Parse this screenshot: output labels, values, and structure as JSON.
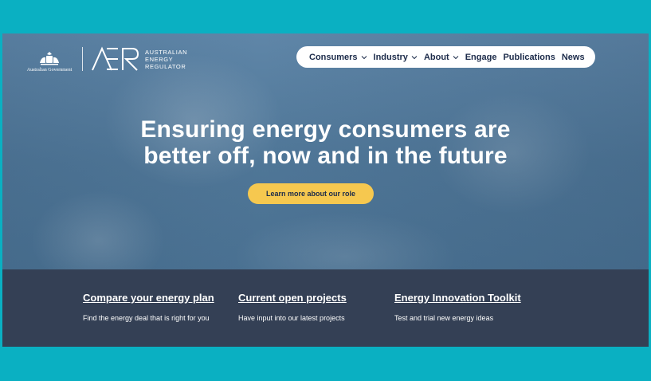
{
  "header": {
    "gov_label": "Australian Government",
    "brand_lines": [
      "Australian",
      "Energy",
      "Regulator"
    ]
  },
  "nav": {
    "items": [
      {
        "label": "Consumers",
        "has_dropdown": true
      },
      {
        "label": "Industry",
        "has_dropdown": true
      },
      {
        "label": "About",
        "has_dropdown": true
      },
      {
        "label": "Engage",
        "has_dropdown": false
      },
      {
        "label": "Publications",
        "has_dropdown": false
      },
      {
        "label": "News",
        "has_dropdown": false
      }
    ],
    "search_icon": "search-icon"
  },
  "hero": {
    "headline_line1": "Ensuring energy consumers are",
    "headline_line2": "better off, now and in the future",
    "cta_label": "Learn more about our role"
  },
  "features": [
    {
      "title": "Compare your energy plan",
      "description": "Find the energy deal that is right for you"
    },
    {
      "title": "Current open projects",
      "description": "Have input into our latest projects"
    },
    {
      "title": "Energy Innovation Toolkit",
      "description": "Test and trial new energy ideas"
    }
  ],
  "colors": {
    "page_border": "#0ab0c2",
    "nav_text": "#1c2b4a",
    "cta_background": "#f6c84f",
    "footer_band": "#344055"
  }
}
